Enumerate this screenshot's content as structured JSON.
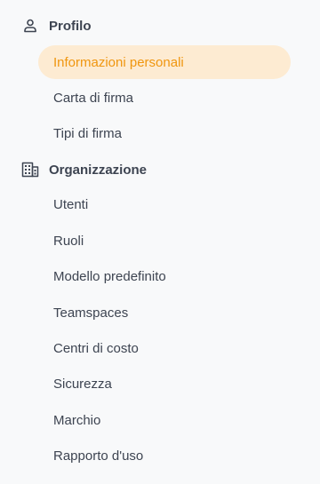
{
  "sidebar": {
    "sections": [
      {
        "title": "Profilo",
        "icon": "user-icon",
        "items": [
          {
            "label": "Informazioni personali",
            "active": true
          },
          {
            "label": "Carta di firma",
            "active": false
          },
          {
            "label": "Tipi di firma",
            "active": false
          }
        ]
      },
      {
        "title": "Organizzazione",
        "icon": "building-icon",
        "items": [
          {
            "label": "Utenti",
            "active": false
          },
          {
            "label": "Ruoli",
            "active": false
          },
          {
            "label": "Modello predefinito",
            "active": false
          },
          {
            "label": "Teamspaces",
            "active": false
          },
          {
            "label": "Centri di costo",
            "active": false
          },
          {
            "label": "Sicurezza",
            "active": false
          },
          {
            "label": "Marchio",
            "active": false
          },
          {
            "label": "Rapporto d'uso",
            "active": false
          }
        ]
      }
    ]
  },
  "colors": {
    "active_bg": "#fdebd2",
    "active_text": "#f0960f",
    "text": "#3d4451",
    "background": "#f8f9fa"
  }
}
